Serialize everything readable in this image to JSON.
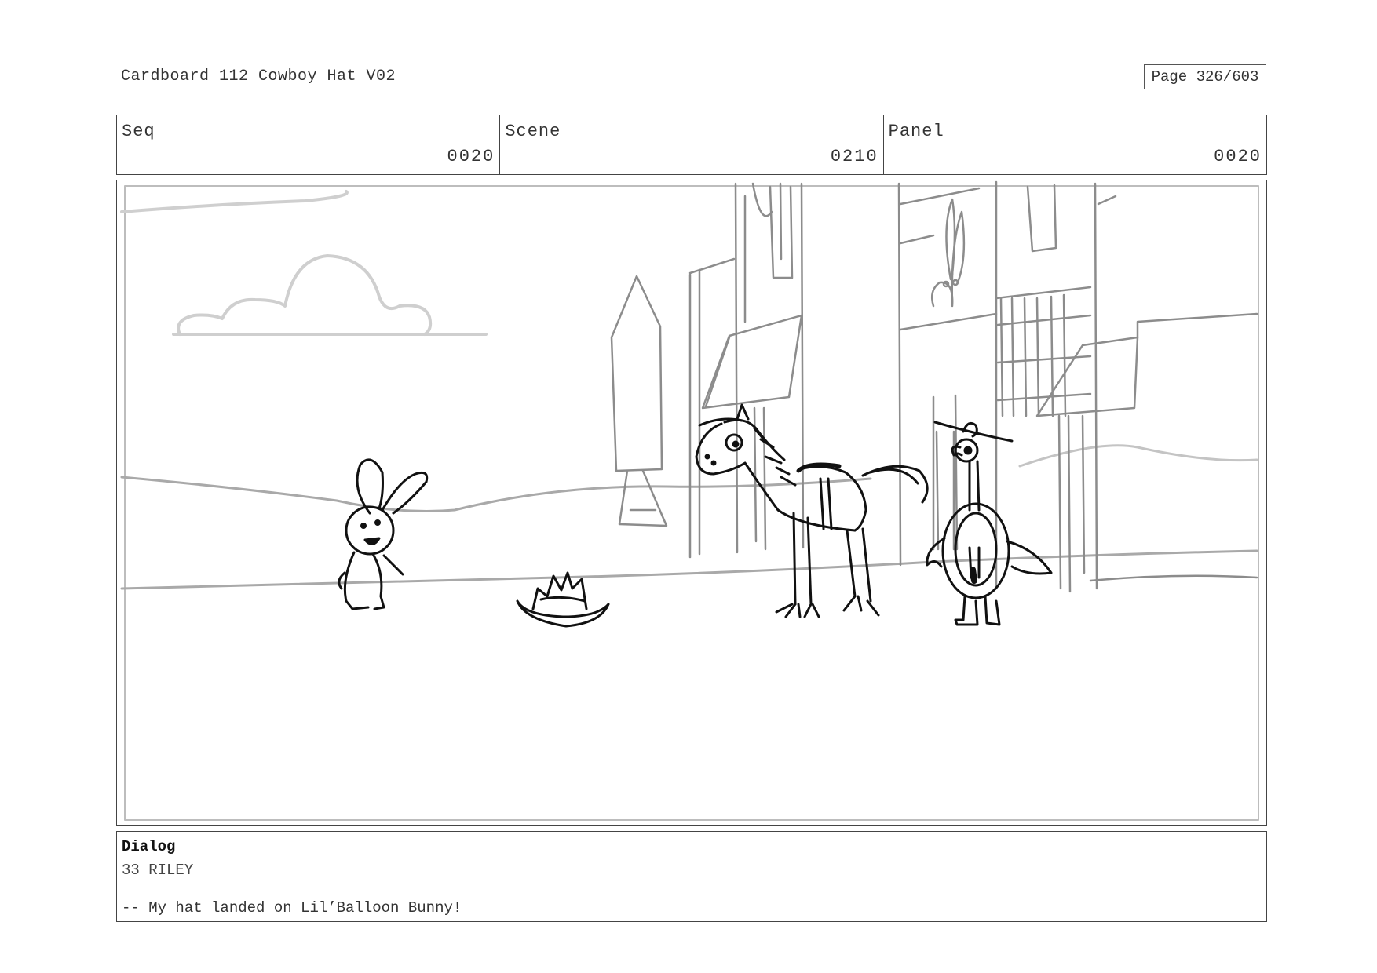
{
  "header": {
    "title": "Cardboard 112 Cowboy Hat V02",
    "page": "Page 326/603"
  },
  "meta": {
    "seq_label": "Seq",
    "seq_value": "0020",
    "scene_label": "Scene",
    "scene_value": "0210",
    "panel_label": "Panel",
    "panel_value": "0020"
  },
  "dialog": {
    "heading": "Dialog",
    "speaker": "33 RILEY",
    "line": "-- My hat landed on Lil’Balloon Bunny!"
  },
  "colors": {
    "sketch_dark": "#111111",
    "sketch_mid": "#8a8a8a",
    "sketch_light": "#c8c8c8",
    "border": "#444444"
  }
}
